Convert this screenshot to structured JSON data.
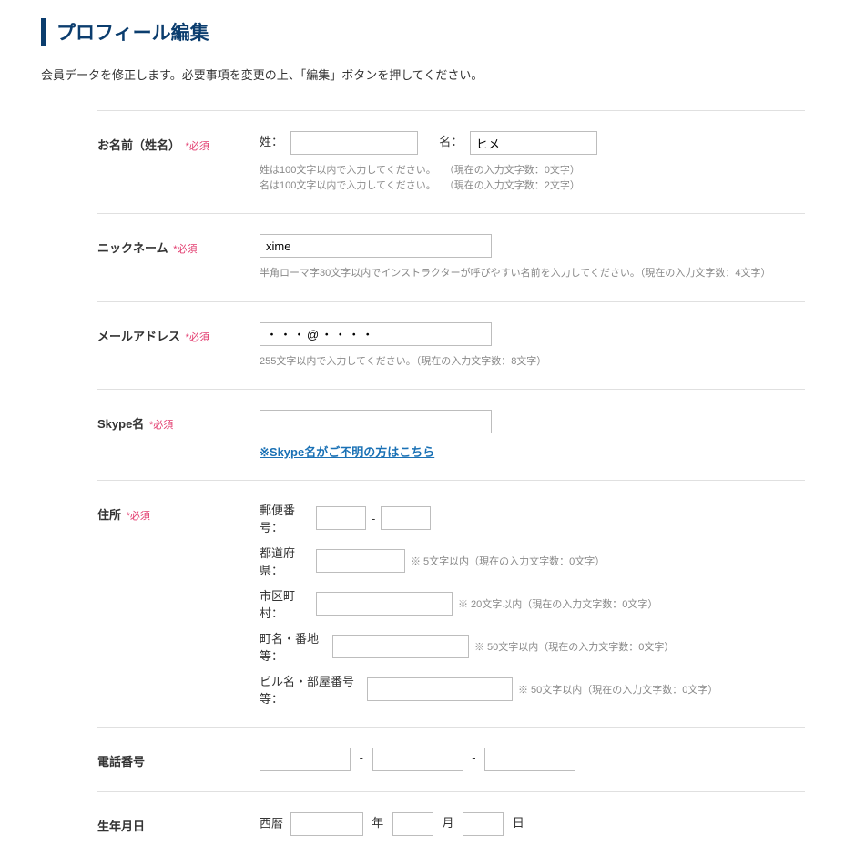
{
  "page_title": "プロフィール編集",
  "page_desc": "会員データを修正します。必要事項を変更の上、「編集」ボタンを押してください。",
  "required_label": "*必須",
  "name": {
    "label": "お名前（姓名）",
    "sei_label": "姓：",
    "mei_label": "名：",
    "sei_value": "",
    "mei_value": "ヒメ",
    "hint1a": "姓は100文字以内で入力してください。",
    "hint1b": "（現在の入力文字数：0文字）",
    "hint2a": "名は100文字以内で入力してください。",
    "hint2b": "（現在の入力文字数：2文字）"
  },
  "nickname": {
    "label": "ニックネーム",
    "value": "xime",
    "hint": "半角ローマ字30文字以内でインストラクターが呼びやすい名前を入力してください。（現在の入力文字数：4文字）"
  },
  "email": {
    "label": "メールアドレス",
    "value": "・・・@・・・・",
    "hint": "255文字以内で入力してください。（現在の入力文字数：8文字）"
  },
  "skype": {
    "label": "Skype名",
    "value": "",
    "link": "※Skype名がご不明の方はこちら"
  },
  "address": {
    "label": "住所",
    "zip_label": "郵便番号：",
    "zip1": "",
    "zip2": "",
    "pref_label": "都道府県：",
    "pref_value": "",
    "pref_hint": "※ 5文字以内（現在の入力文字数：0文字）",
    "city_label": "市区町村：",
    "city_value": "",
    "city_hint": "※ 20文字以内（現在の入力文字数：0文字）",
    "town_label": "町名・番地等：",
    "town_value": "",
    "town_hint": "※ 50文字以内（現在の入力文字数：0文字）",
    "bldg_label": "ビル名・部屋番号等：",
    "bldg_value": "",
    "bldg_hint": "※ 50文字以内（現在の入力文字数：0文字）",
    "dash": "-"
  },
  "phone": {
    "label": "電話番号",
    "p1": "",
    "p2": "",
    "p3": "",
    "dash": "-"
  },
  "birth": {
    "label": "生年月日",
    "era": "西暦",
    "year": "",
    "month": "",
    "day": "",
    "y_label": "年",
    "m_label": "月",
    "d_label": "日"
  }
}
